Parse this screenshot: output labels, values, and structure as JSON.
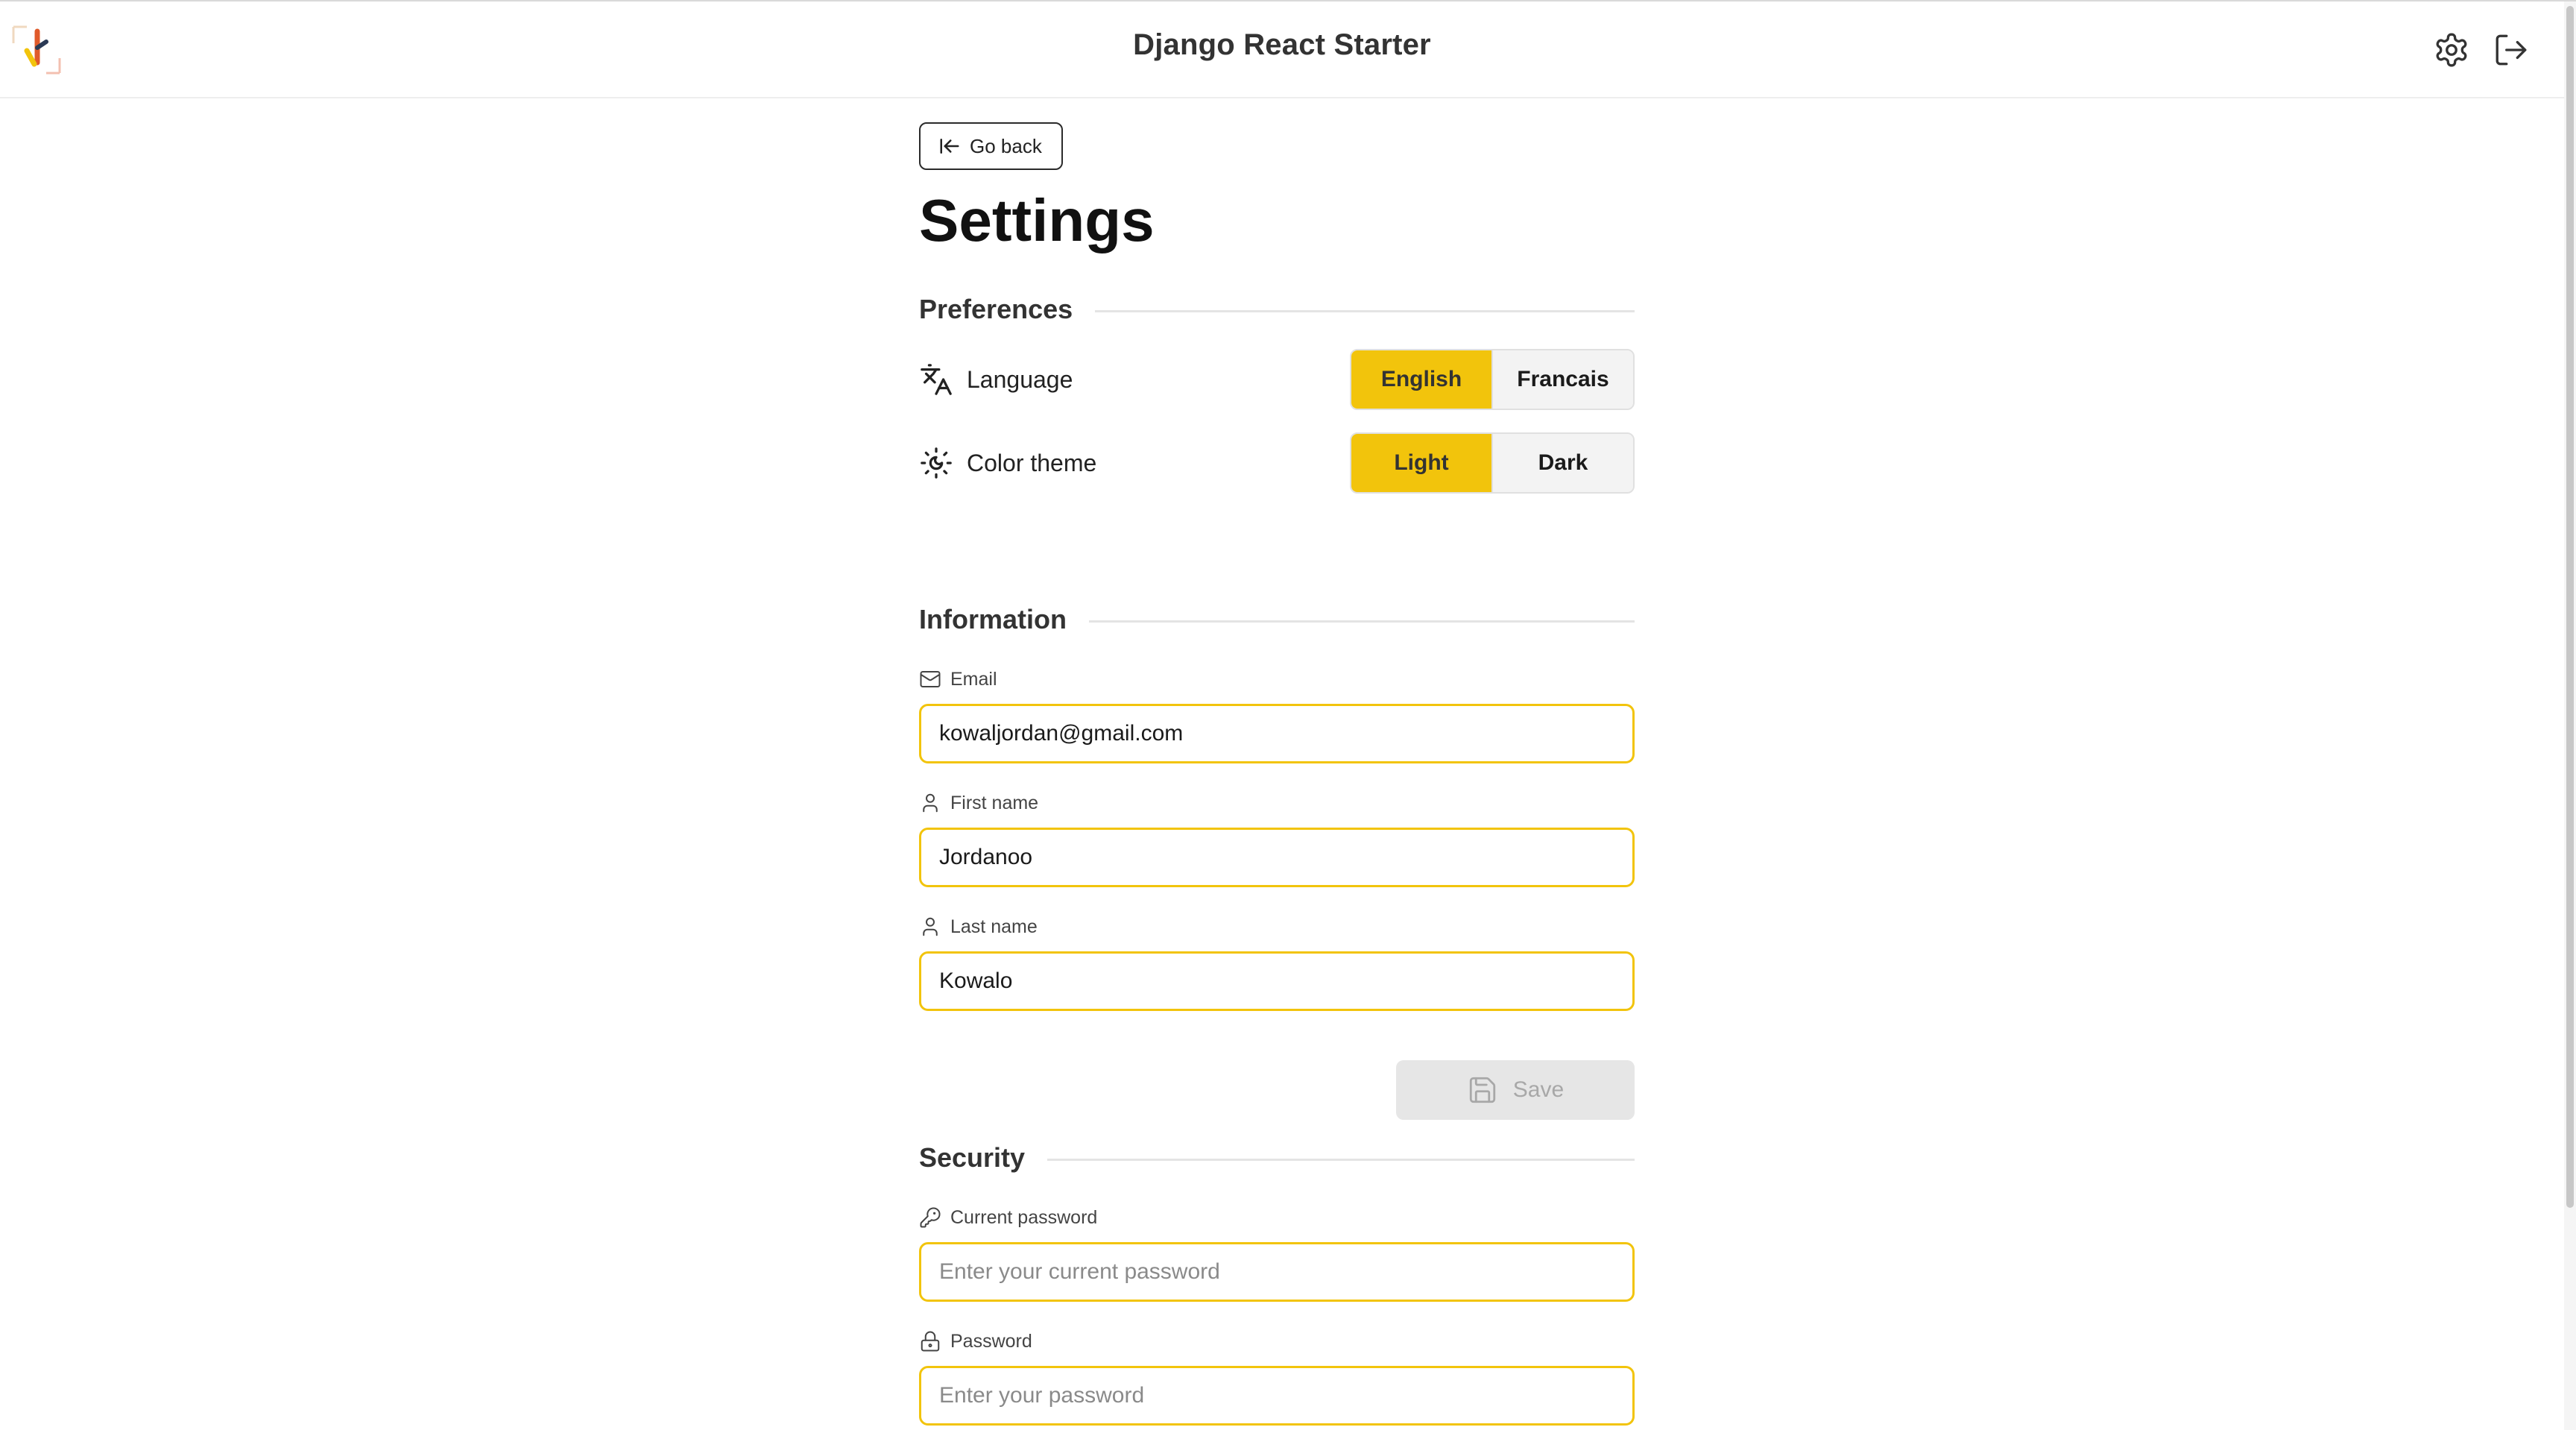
{
  "app": {
    "title": "Django React Starter"
  },
  "header": {
    "logo_icon": "brand-logo",
    "settings_icon": "gear-icon",
    "logout_icon": "logout-icon"
  },
  "page": {
    "back_label": "Go back",
    "title": "Settings"
  },
  "preferences": {
    "heading": "Preferences",
    "language": {
      "label": "Language",
      "icon": "translate-icon",
      "options": [
        "English",
        "Francais"
      ],
      "selected": "English"
    },
    "theme": {
      "label": "Color theme",
      "icon": "sun-moon-icon",
      "options": [
        "Light",
        "Dark"
      ],
      "selected": "Light"
    }
  },
  "information": {
    "heading": "Information",
    "email": {
      "label": "Email",
      "value": "kowaljordan@gmail.com",
      "icon": "mail-icon"
    },
    "first_name": {
      "label": "First name",
      "value": "Jordanoo",
      "icon": "user-icon"
    },
    "last_name": {
      "label": "Last name",
      "value": "Kowalo",
      "icon": "user-icon"
    },
    "save_label": "Save"
  },
  "security": {
    "heading": "Security",
    "current_password": {
      "label": "Current password",
      "placeholder": "Enter your current password",
      "icon": "key-icon"
    },
    "password": {
      "label": "Password",
      "placeholder": "Enter your password",
      "icon": "lock-icon"
    }
  },
  "colors": {
    "accent": "#f2c40c",
    "disabled_bg": "#e6e6e6",
    "disabled_text": "#a8a8a8"
  }
}
